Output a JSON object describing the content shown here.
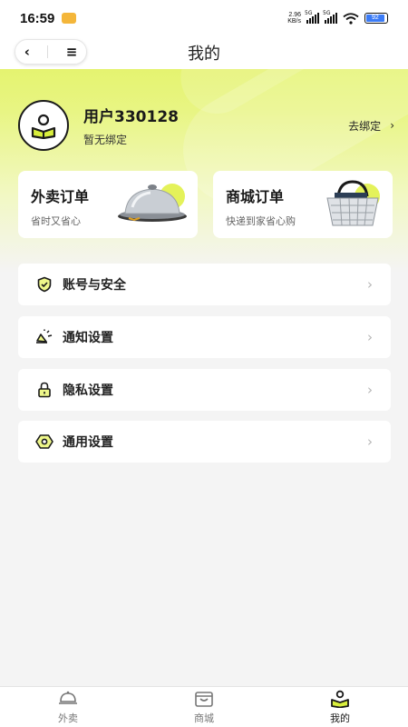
{
  "status_bar": {
    "time": "16:59",
    "net_speed_value": "2.96",
    "net_speed_unit": "KB/s",
    "signal1_tag": "5G",
    "signal2_tag": "5G",
    "battery": "92"
  },
  "header": {
    "back_icon": "‹",
    "menu_icon": "≡",
    "title": "我的"
  },
  "profile": {
    "username": "用户330128",
    "bind_status": "暂无绑定",
    "bind_link": "去绑定",
    "bind_arrow": "›"
  },
  "order_cards": [
    {
      "title": "外卖订单",
      "subtitle": "省时又省心",
      "icon": "serving-cloche-icon"
    },
    {
      "title": "商城订单",
      "subtitle": "快递到家省心购",
      "icon": "shopping-basket-icon"
    }
  ],
  "menu": [
    {
      "label": "账号与安全",
      "icon": "shield-check-icon",
      "arrow": "›"
    },
    {
      "label": "通知设置",
      "icon": "megaphone-icon",
      "arrow": "›"
    },
    {
      "label": "隐私设置",
      "icon": "lock-icon",
      "arrow": "›"
    },
    {
      "label": "通用设置",
      "icon": "hexagon-settings-icon",
      "arrow": "›"
    }
  ],
  "tabbar": [
    {
      "label": "外卖",
      "icon": "takeout-icon",
      "active": false
    },
    {
      "label": "商城",
      "icon": "shop-bag-icon",
      "active": false
    },
    {
      "label": "我的",
      "icon": "profile-icon",
      "active": true
    }
  ],
  "colors": {
    "accent": "#d9ef3c",
    "text_dark": "#1a1a1a",
    "background": "#f4f4f4"
  }
}
